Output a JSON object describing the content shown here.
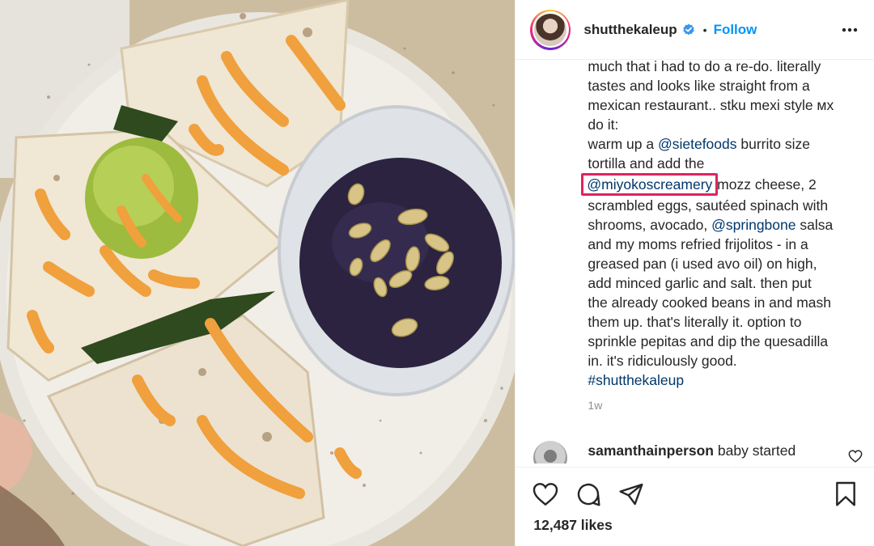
{
  "post": {
    "image": {
      "description_icon": "quesadilla-photo"
    },
    "header": {
      "username": "shutthekaleup",
      "verified_icon": "verified-badge-icon",
      "separator": "•",
      "follow_label": "Follow",
      "more_icon": "more-options-icon"
    },
    "caption": {
      "lines": [
        "much that i had to do a re-do. literally",
        "tastes and looks like straight from a",
        "mexican restaurant.. stku mexi style мх",
        "do it:"
      ],
      "line5_pre": "warm up a ",
      "mention_1": "@sietefoods",
      "line5_post": " burrito size",
      "line6": "tortilla and add the",
      "mention_2": "@miyokoscreamery",
      "line7_post": " mozz cheese, 2",
      "line8": "scrambled eggs, sautéed spinach with",
      "line9_pre": "shrooms, avocado, ",
      "mention_3": "@springbone",
      "line9_post": " salsa",
      "lines_rest": [
        "and my moms refried frijolitos - in a",
        "greased pan (i used avo oil) on high,",
        "add minced garlic and salt. then put",
        "the already cooked beans in and mash",
        "them up. that's literally it. option to",
        "sprinkle pepitas and dip the quesadilla",
        "in. it's ridiculously good."
      ],
      "hashtag": "#shutthekaleup"
    },
    "timestamp": "1w",
    "comment": {
      "username": "samanthainperson",
      "text": " baby started"
    },
    "likes": "12,487 likes"
  },
  "colors": {
    "accent": "#0095f6",
    "mention": "#00376b",
    "highlight_border": "#e0245e"
  }
}
